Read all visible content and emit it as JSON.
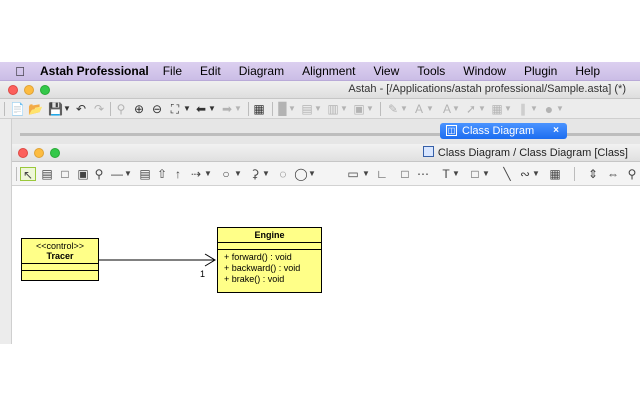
{
  "menubar": {
    "app_name": "Astah Professional",
    "items": [
      "File",
      "Edit",
      "Diagram",
      "Alignment",
      "View",
      "Tools",
      "Window",
      "Plugin",
      "Help"
    ]
  },
  "main_window": {
    "title": "Astah - [/Applications/astah professional/Sample.asta] (*)"
  },
  "tab": {
    "label": "Class Diagram",
    "close_glyph": "×"
  },
  "diagram_window": {
    "title": "Class Diagram / Class Diagram [Class]"
  },
  "diagram": {
    "classes": [
      {
        "stereotype": "<<control>>",
        "name": "Tracer",
        "operations": []
      },
      {
        "stereotype": "",
        "name": "Engine",
        "operations": [
          "+ forward() : void",
          "+ backward() : void",
          "+ brake() : void"
        ]
      }
    ],
    "association": {
      "target_multiplicity": "1"
    }
  },
  "colors": {
    "class_fill": "#ffff88",
    "tab_blue": "#1c6df0",
    "menubar_tint": "#cbbde6"
  }
}
